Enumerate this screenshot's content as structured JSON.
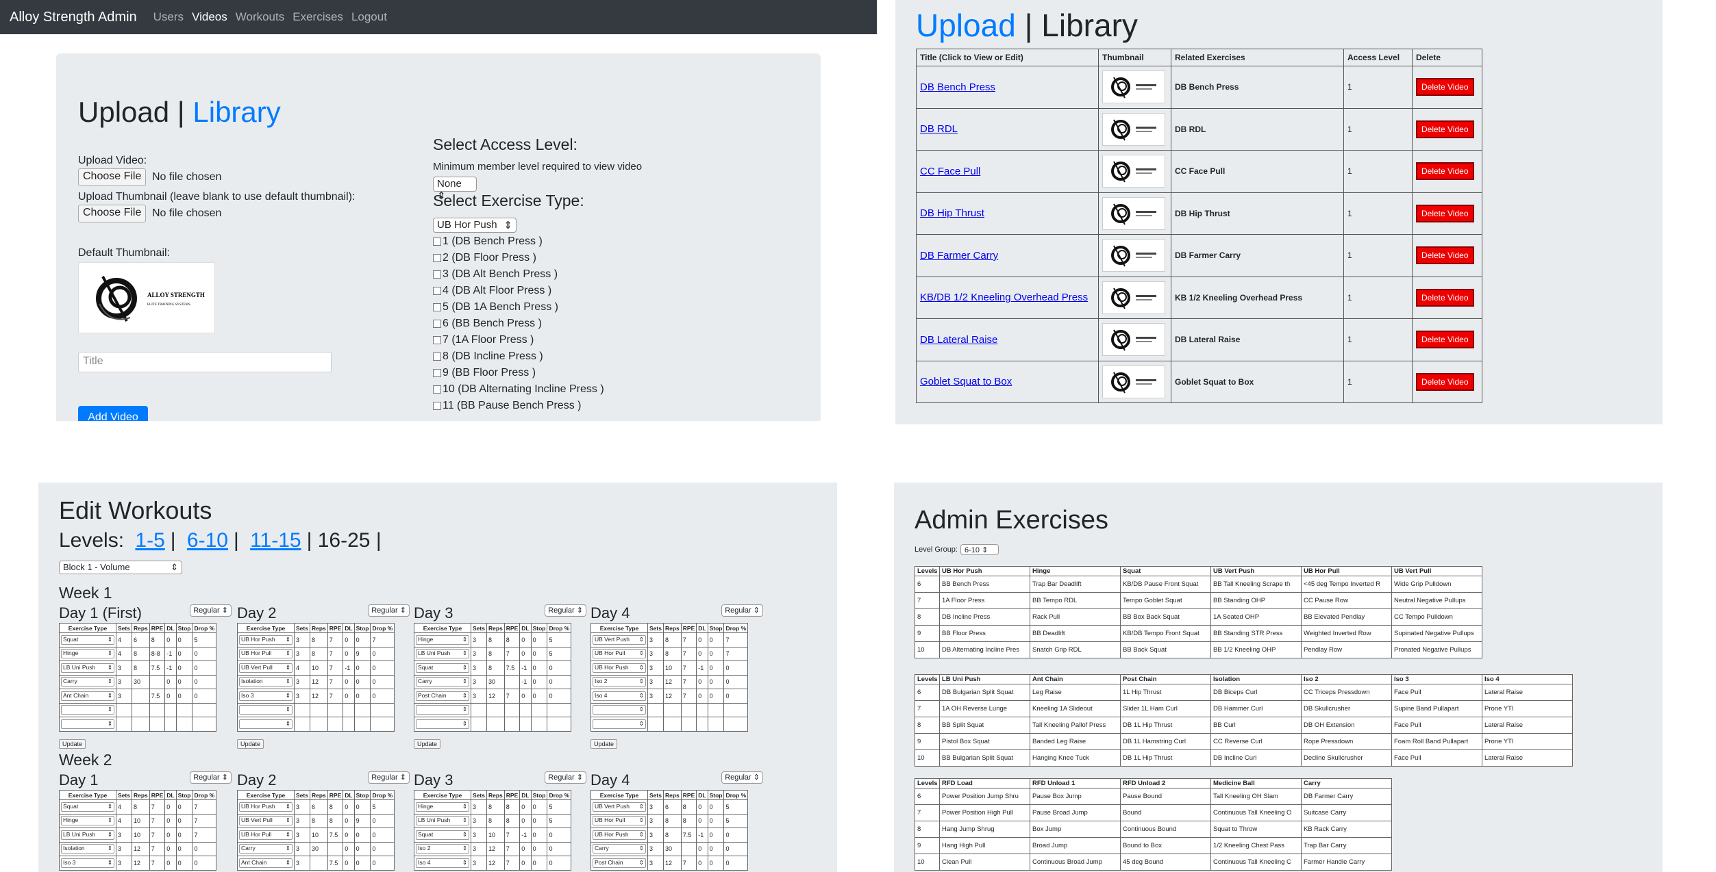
{
  "q1": {
    "brand": "Alloy Strength Admin",
    "nav": [
      "Users",
      "Videos",
      "Workouts",
      "Exercises",
      "Logout"
    ],
    "active_nav": "Videos",
    "heading_upload": "Upload",
    "heading_sep": "|",
    "heading_library": "Library",
    "upload_video_label": "Upload Video:",
    "choose_file": "Choose File",
    "no_file": "No file chosen",
    "upload_thumb_label": "Upload Thumbnail (leave blank to use default thumbnail):",
    "default_thumb_label": "Default Thumbnail:",
    "thumb_logo_text": "ALLOY STRENGTH",
    "thumb_logo_sub": "ELITE TRAINING SYSTEMS",
    "title_placeholder": "Title",
    "add_button": "Add Video",
    "access_heading": "Select Access Level:",
    "access_help": "Minimum member level required to view video",
    "access_value": "None",
    "type_heading": "Select Exercise Type:",
    "type_value": "UB Hor Push",
    "exercises": [
      "1 (DB Bench Press )",
      "2 (DB Floor Press )",
      "3 (DB Alt Bench Press )",
      "4 (DB Alt Floor Press )",
      "5 (DB 1A Bench Press )",
      "6 (BB Bench Press )",
      "7 (1A Floor Press )",
      "8 (DB Incline Press )",
      "9 (BB Floor Press )",
      "10 (DB Alternating Incline Press )",
      "11 (BB Pause Bench Press )"
    ]
  },
  "q2": {
    "heading_upload": "Upload",
    "heading_sep": "|",
    "heading_library": "Library",
    "headers": [
      "Title (Click to View or Edit)",
      "Thumbnail",
      "Related Exercises",
      "Access Level",
      "Delete"
    ],
    "rows": [
      {
        "title": "DB Bench Press",
        "related": "DB Bench Press",
        "access": "1"
      },
      {
        "title": "DB RDL",
        "related": "DB RDL",
        "access": "1"
      },
      {
        "title": "CC Face Pull",
        "related": "CC Face Pull",
        "access": "1"
      },
      {
        "title": "DB Hip Thrust",
        "related": "DB Hip Thrust",
        "access": "1"
      },
      {
        "title": "DB Farmer Carry",
        "related": "DB Farmer Carry",
        "access": "1"
      },
      {
        "title": "KB/DB 1/2 Kneeling Overhead Press",
        "related": "KB 1/2 Kneeling Overhead Press",
        "access": "1"
      },
      {
        "title": "DB Lateral Raise",
        "related": "DB Lateral Raise",
        "access": "1"
      },
      {
        "title": "Goblet Squat to Box",
        "related": "Goblet Squat to Box",
        "access": "1"
      }
    ],
    "delete_label": "Delete Video"
  },
  "q3": {
    "title": "Edit Workouts",
    "levels_label": "Levels:",
    "level_links": [
      "1-5",
      "6-10",
      "11-15"
    ],
    "level_current": "16-25",
    "block_value": "Block 1 - Volume",
    "regular": "Regular",
    "update": "Update",
    "col_headers": [
      "Exercise Type",
      "Sets",
      "Reps",
      "RPE",
      "DL",
      "Stop",
      "Drop %"
    ],
    "weeks": [
      {
        "label": "Week 1",
        "days": [
          {
            "label": "Day 1 (First)",
            "rows": [
              [
                "Squat",
                "4",
                "6",
                "8",
                "0",
                "0",
                "5"
              ],
              [
                "Hinge",
                "4",
                "8",
                "8-8",
                "-1",
                "0",
                "0"
              ],
              [
                "LB Uni Push",
                "3",
                "8",
                "7.5",
                "-1",
                "0",
                "0"
              ],
              [
                "Carry",
                "3",
                "30",
                "",
                "0",
                "0",
                "0"
              ],
              [
                "Ant Chain",
                "3",
                "",
                "7.5",
                "0",
                "0",
                "0"
              ],
              [
                "",
                "",
                "",
                "",
                "",
                "",
                ""
              ],
              [
                "",
                "",
                "",
                "",
                "",
                "",
                ""
              ]
            ]
          },
          {
            "label": "Day 2",
            "rows": [
              [
                "UB Hor Push",
                "3",
                "8",
                "7",
                "0",
                "0",
                "7"
              ],
              [
                "UB Hor Pull",
                "3",
                "8",
                "7",
                "0",
                "9",
                "0"
              ],
              [
                "UB Vert Pull",
                "4",
                "10",
                "7",
                "-1",
                "0",
                "0"
              ],
              [
                "Isolation",
                "3",
                "12",
                "7",
                "0",
                "0",
                "0"
              ],
              [
                "Iso 3",
                "3",
                "12",
                "7",
                "0",
                "0",
                "0"
              ],
              [
                "",
                "",
                "",
                "",
                "",
                "",
                ""
              ],
              [
                "",
                "",
                "",
                "",
                "",
                "",
                ""
              ]
            ]
          },
          {
            "label": "Day 3",
            "rows": [
              [
                "Hinge",
                "3",
                "8",
                "8",
                "0",
                "0",
                "5"
              ],
              [
                "LB Uni Push",
                "3",
                "8",
                "7",
                "0",
                "0",
                "5"
              ],
              [
                "Squat",
                "3",
                "8",
                "7.5",
                "-1",
                "0",
                "0"
              ],
              [
                "Carry",
                "3",
                "30",
                "",
                "-1",
                "0",
                "0"
              ],
              [
                "Post Chain",
                "3",
                "12",
                "7",
                "0",
                "0",
                "0"
              ],
              [
                "",
                "",
                "",
                "",
                "",
                "",
                ""
              ],
              [
                "",
                "",
                "",
                "",
                "",
                "",
                ""
              ]
            ]
          },
          {
            "label": "Day 4",
            "rows": [
              [
                "UB Vert Push",
                "3",
                "8",
                "7",
                "0",
                "0",
                "7"
              ],
              [
                "UB Hor Pull",
                "3",
                "8",
                "7",
                "0",
                "0",
                "7"
              ],
              [
                "UB Hor Push",
                "3",
                "10",
                "7",
                "-1",
                "0",
                "0"
              ],
              [
                "Iso 2",
                "3",
                "12",
                "7",
                "0",
                "0",
                "0"
              ],
              [
                "Iso 4",
                "3",
                "12",
                "7",
                "0",
                "0",
                "0"
              ],
              [
                "",
                "",
                "",
                "",
                "",
                "",
                ""
              ],
              [
                "",
                "",
                "",
                "",
                "",
                "",
                ""
              ]
            ]
          }
        ]
      },
      {
        "label": "Week 2",
        "days": [
          {
            "label": "Day 1",
            "rows": [
              [
                "Squat",
                "4",
                "8",
                "7",
                "0",
                "0",
                "7"
              ],
              [
                "Hinge",
                "4",
                "10",
                "7",
                "0",
                "0",
                "7"
              ],
              [
                "LB Uni Push",
                "3",
                "10",
                "7",
                "0",
                "0",
                "7"
              ],
              [
                "Isolation",
                "3",
                "12",
                "7",
                "0",
                "0",
                "0"
              ],
              [
                "Iso 3",
                "3",
                "12",
                "7",
                "0",
                "0",
                "0"
              ]
            ]
          },
          {
            "label": "Day 2",
            "rows": [
              [
                "UB Hor Push",
                "3",
                "6",
                "8",
                "0",
                "0",
                "5"
              ],
              [
                "UB Vert Pull",
                "3",
                "8",
                "8",
                "0",
                "9",
                "0"
              ],
              [
                "UB Hor Pull",
                "3",
                "10",
                "7.5",
                "0",
                "0",
                "0"
              ],
              [
                "Carry",
                "3",
                "30",
                "",
                "0",
                "0",
                "0"
              ],
              [
                "Ant Chain",
                "3",
                "",
                "7.5",
                "0",
                "0",
                "0"
              ]
            ]
          },
          {
            "label": "Day 3",
            "rows": [
              [
                "Hinge",
                "3",
                "8",
                "8",
                "0",
                "0",
                "5"
              ],
              [
                "LB Uni Push",
                "3",
                "8",
                "8",
                "0",
                "0",
                "5"
              ],
              [
                "Squat",
                "3",
                "10",
                "7",
                "-1",
                "0",
                "0"
              ],
              [
                "Iso 2",
                "3",
                "12",
                "7",
                "0",
                "0",
                "0"
              ],
              [
                "Iso 4",
                "3",
                "12",
                "7",
                "0",
                "0",
                "0"
              ]
            ]
          },
          {
            "label": "Day 4",
            "rows": [
              [
                "UB Vert Push",
                "3",
                "6",
                "8",
                "0",
                "0",
                "5"
              ],
              [
                "UB Hor Pull",
                "3",
                "8",
                "8",
                "0",
                "0",
                "5"
              ],
              [
                "UB Hor Push",
                "3",
                "8",
                "7.5",
                "-1",
                "0",
                "0"
              ],
              [
                "Carry",
                "3",
                "30",
                "",
                "0",
                "0",
                "0"
              ],
              [
                "Post Chain",
                "3",
                "12",
                "7",
                "0",
                "0",
                "0"
              ]
            ]
          }
        ]
      }
    ]
  },
  "q4": {
    "title": "Admin Exercises",
    "level_group_label": "Level Group:",
    "level_group_value": "6-10",
    "tables": [
      {
        "headers": [
          "Levels",
          "UB Hor Push",
          "Hinge",
          "Squat",
          "UB Vert Push",
          "UB Hor Pull",
          "UB Vert Pull"
        ],
        "rows": [
          [
            "6",
            "BB Bench Press",
            "Trap Bar Deadlift",
            "KB/DB Pause Front Squat",
            "BB Tall Kneeling Scrape th",
            "<45 deg Tempo Inverted R",
            "Wide Grip Pulldown"
          ],
          [
            "7",
            "1A Floor Press",
            "BB Tempo RDL",
            "Tempo Goblet Squat",
            "BB Standing OHP",
            "CC Pause Row",
            "Neutral Negative Pullups"
          ],
          [
            "8",
            "DB Incline Press",
            "Rack Pull",
            "BB Box Back Squat",
            "1A Seated OHP",
            "BB Elevated Pendlay",
            "CC Tempo Pulldown"
          ],
          [
            "9",
            "BB Floor Press",
            "BB Deadlift",
            "KB/DB Tempo Front Squat",
            "BB Standing STR Press",
            "Weighted Inverted Row",
            "Supinated Negative Pullups"
          ],
          [
            "10",
            "DB Alternating Incline Pres",
            "Snatch Grip RDL",
            "BB Back Squat",
            "BB 1/2 Kneeling OHP",
            "Pendlay Row",
            "Pronated Negative Pullups"
          ]
        ]
      },
      {
        "headers": [
          "Levels",
          "LB Uni Push",
          "Ant Chain",
          "Post Chain",
          "Isolation",
          "Iso 2",
          "Iso 3",
          "Iso 4"
        ],
        "rows": [
          [
            "6",
            "DB Bulgarian Split Squat",
            "Leg Raise",
            "1L Hip Thrust",
            "DB Biceps Curl",
            "CC Triceps Pressdown",
            "Face Pull",
            "Lateral Raise"
          ],
          [
            "7",
            "1A OH Reverse Lunge",
            "Kneeling 1A Slideout",
            "Slider 1L Ham Curl",
            "DB Hammer Curl",
            "DB Skullcrusher",
            "Supine Band Pullapart",
            "Prone YTI"
          ],
          [
            "8",
            "BB Split Squat",
            "Tall Kneeling Pallof Press",
            "DB 1L Hip Thrust",
            "BB Curl",
            "DB OH Extension",
            "Face Pull",
            "Lateral Raise"
          ],
          [
            "9",
            "Pistol Box Squat",
            "Banded Leg Raise",
            "DB 1L Hamstring Curl",
            "CC Reverse Curl",
            "Rope Pressdown",
            "Foam Roll Band Pullapart",
            "Prone YTI"
          ],
          [
            "10",
            "BB Bulgarian Split Squat",
            "Hanging Knee Tuck",
            "DB 1L Hip Thrust",
            "DB Incline Curl",
            "Decline Skullcrusher",
            "Face Pull",
            "Lateral Raise"
          ]
        ]
      },
      {
        "headers": [
          "Levels",
          "RFD Load",
          "RFD Unload 1",
          "RFD Unload 2",
          "Medicine Ball",
          "Carry"
        ],
        "rows": [
          [
            "6",
            "Power Position Jump Shru",
            "Pause Box Jump",
            "Pause Bound",
            "Tall Kneeling OH Slam",
            "DB Farmer Carry"
          ],
          [
            "7",
            "Power Position High Pull",
            "Pause Broad Jump",
            "Bound",
            "Continuous Tall Kneeling O",
            "Suitcase Carry"
          ],
          [
            "8",
            "Hang Jump Shrug",
            "Box Jump",
            "Continuous Bound",
            "Squat to Throw",
            "KB Rack Carry"
          ],
          [
            "9",
            "Hang High Pull",
            "Broad Jump",
            "Bound to Box",
            "1/2 Kneeling Chest Pass",
            "Trap Bar Carry"
          ],
          [
            "10",
            "Clean Pull",
            "Continuous Broad Jump",
            "45 deg Bound",
            "Continuous Tall Kneeling C",
            "Farmer Handle Carry"
          ]
        ]
      }
    ]
  }
}
